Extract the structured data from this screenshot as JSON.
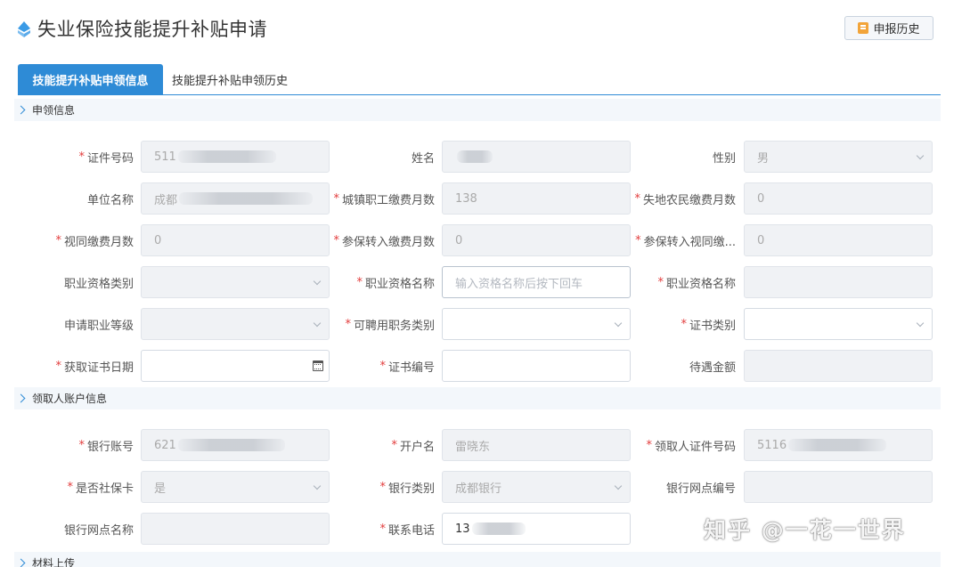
{
  "header": {
    "title": "失业保险技能提升补贴申请",
    "history_button": "申报历史",
    "title_icon": "diamond-icon",
    "history_icon": "document-icon"
  },
  "tabs": [
    {
      "label": "技能提升补贴申领信息",
      "active": true
    },
    {
      "label": "技能提升补贴申领历史",
      "active": false
    }
  ],
  "colors": {
    "accent": "#2e8bd6",
    "required": "#e23c3c",
    "section_bg": "#f3f7fb",
    "disabled_bg": "#f0f2f5"
  },
  "sections": {
    "apply_info": "申领信息",
    "account_info": "领取人账户信息",
    "materials": "材料上传"
  },
  "apply_fields": {
    "id_number": {
      "label": "证件号码",
      "value": "511"
    },
    "name": {
      "label": "姓名",
      "value": ""
    },
    "gender": {
      "label": "性别",
      "value": "男"
    },
    "company": {
      "label": "单位名称",
      "value": "成都"
    },
    "urban_months": {
      "label": "城镇职工缴费月数",
      "value": "138"
    },
    "farmer_months": {
      "label": "失地农民缴费月数",
      "value": "0"
    },
    "deemed_months": {
      "label": "视同缴费月数",
      "value": "0"
    },
    "transfer_months": {
      "label": "参保转入缴费月数",
      "value": "0"
    },
    "transfer_deemed": {
      "label": "参保转入视同缴...",
      "value": "0"
    },
    "qual_category": {
      "label": "职业资格类别",
      "value": ""
    },
    "qual_name_input": {
      "label": "职业资格名称",
      "placeholder": "输入资格名称后按下回车"
    },
    "qual_name": {
      "label": "职业资格名称",
      "value": ""
    },
    "apply_level": {
      "label": "申请职业等级",
      "value": ""
    },
    "job_category": {
      "label": "可聘用职务类别",
      "value": ""
    },
    "cert_category": {
      "label": "证书类别",
      "value": ""
    },
    "cert_date": {
      "label": "获取证书日期",
      "value": ""
    },
    "cert_number": {
      "label": "证书编号",
      "value": ""
    },
    "benefit_amount": {
      "label": "待遇金额",
      "value": ""
    }
  },
  "account_fields": {
    "bank_account": {
      "label": "银行账号",
      "value": "621"
    },
    "account_name": {
      "label": "开户名",
      "value": "雷晓东"
    },
    "recipient_id": {
      "label": "领取人证件号码",
      "value": "5116"
    },
    "is_social_card": {
      "label": "是否社保卡",
      "value": "是"
    },
    "bank_type": {
      "label": "银行类别",
      "value": "成都银行"
    },
    "branch_code": {
      "label": "银行网点编号",
      "value": ""
    },
    "branch_name": {
      "label": "银行网点名称",
      "value": ""
    },
    "phone": {
      "label": "联系电话",
      "value": "13"
    }
  },
  "watermark": "知乎 @一花一世界"
}
